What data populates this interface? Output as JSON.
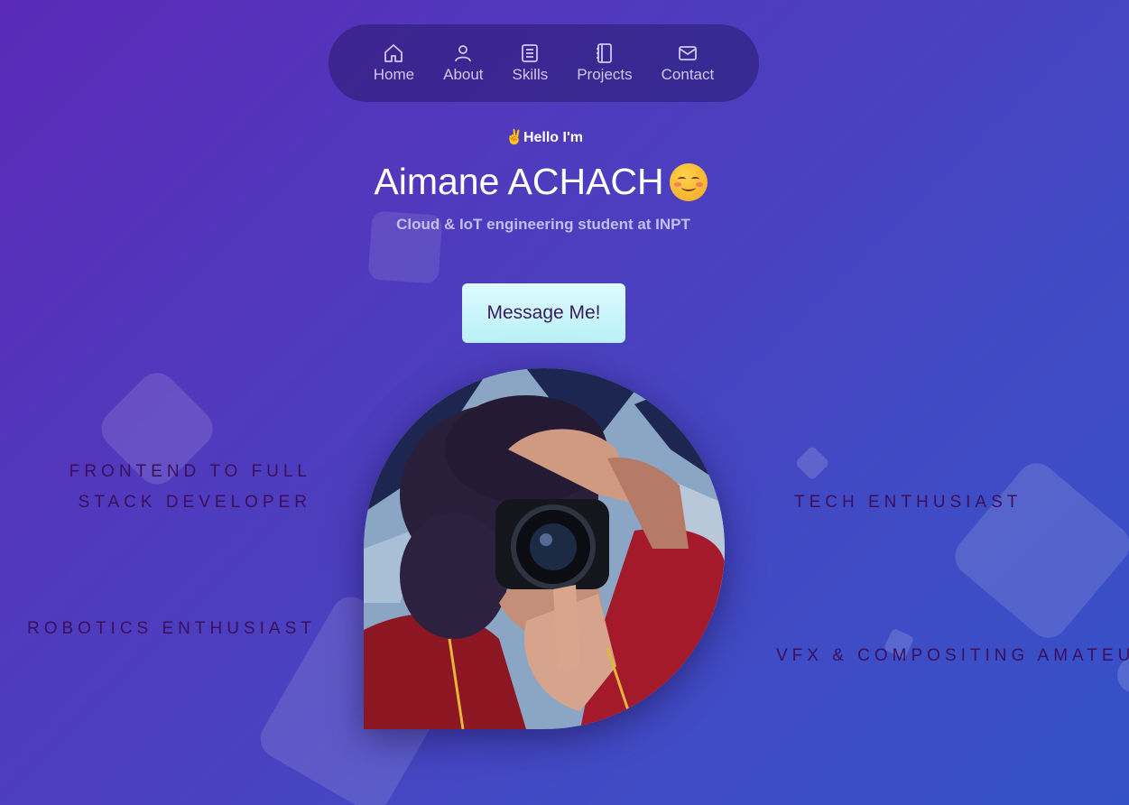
{
  "nav": {
    "items": [
      {
        "label": "Home",
        "icon": "home-icon"
      },
      {
        "label": "About",
        "icon": "user-icon"
      },
      {
        "label": "Skills",
        "icon": "document-icon"
      },
      {
        "label": "Projects",
        "icon": "notebook-icon"
      },
      {
        "label": "Contact",
        "icon": "mail-icon"
      }
    ]
  },
  "hero": {
    "greeting_emoji": "✌",
    "greeting": "Hello I'm",
    "name": "Aimane ACHACH",
    "subtitle": "Cloud & IoT engineering student at INPT",
    "cta_label": "Message Me!"
  },
  "roles": {
    "left_top": "FRONTEND TO FULL STACK DEVELOPER",
    "right_top": "TECH ENTHUSIAST",
    "left_bottom": "ROBOTICS ENTHUSIAST",
    "right_bottom": "VFX & COMPOSITING AMATEUR"
  },
  "colors": {
    "background_start": "#5b2ab8",
    "background_end": "#3551c8",
    "nav_pill": "#2a1a6e",
    "cta_background": "#c8f6fb",
    "role_text": "#3b0f5c"
  }
}
